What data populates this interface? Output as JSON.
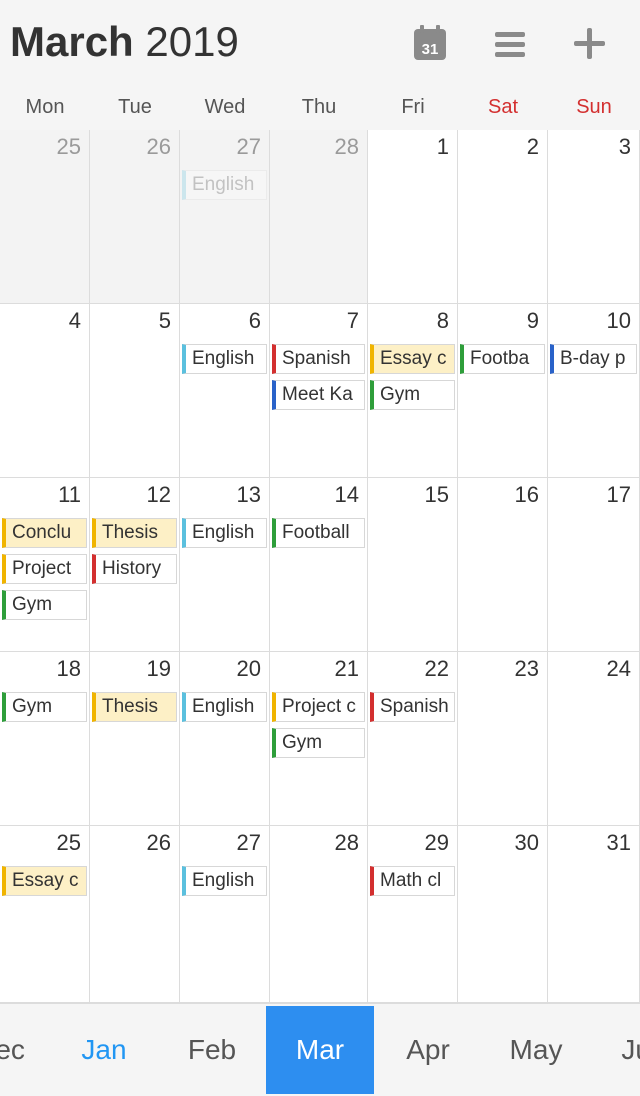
{
  "header": {
    "month": "March",
    "year": "2019",
    "calendar_icon_day": "31"
  },
  "weekdays": [
    "Mon",
    "Tue",
    "Wed",
    "Thu",
    "Fri",
    "Sat",
    "Sun"
  ],
  "weeks": [
    [
      {
        "day": "25",
        "out": true,
        "events": []
      },
      {
        "day": "26",
        "out": true,
        "events": []
      },
      {
        "day": "27",
        "out": true,
        "events": [
          {
            "label": "English",
            "color": "#5bc0de",
            "faded": true
          }
        ]
      },
      {
        "day": "28",
        "out": true,
        "events": []
      },
      {
        "day": "1",
        "events": []
      },
      {
        "day": "2",
        "events": []
      },
      {
        "day": "3",
        "events": []
      }
    ],
    [
      {
        "day": "4",
        "events": []
      },
      {
        "day": "5",
        "events": []
      },
      {
        "day": "6",
        "events": [
          {
            "label": "English",
            "color": "#5bc0de"
          }
        ]
      },
      {
        "day": "7",
        "events": [
          {
            "label": "Spanish",
            "color": "#d32f2f"
          },
          {
            "label": "Meet Ka",
            "color": "#2962c9"
          }
        ]
      },
      {
        "day": "8",
        "events": [
          {
            "label": "Essay c",
            "color": "#f0b400",
            "hl": true
          },
          {
            "label": "Gym",
            "color": "#2e9e3a"
          }
        ]
      },
      {
        "day": "9",
        "events": [
          {
            "label": "Footba",
            "color": "#2e9e3a"
          }
        ]
      },
      {
        "day": "10",
        "events": [
          {
            "label": "B-day p",
            "color": "#2962c9"
          }
        ]
      }
    ],
    [
      {
        "day": "11",
        "events": [
          {
            "label": "Conclu",
            "color": "#f0b400",
            "hl": true
          },
          {
            "label": "Project",
            "color": "#f0b400"
          },
          {
            "label": "Gym",
            "color": "#2e9e3a"
          }
        ]
      },
      {
        "day": "12",
        "events": [
          {
            "label": "Thesis",
            "color": "#f0b400",
            "hl": true
          },
          {
            "label": "History",
            "color": "#d32f2f"
          }
        ]
      },
      {
        "day": "13",
        "events": [
          {
            "label": "English",
            "color": "#5bc0de"
          }
        ]
      },
      {
        "day": "14",
        "events": [
          {
            "label": "Football",
            "color": "#2e9e3a"
          }
        ]
      },
      {
        "day": "15",
        "events": []
      },
      {
        "day": "16",
        "events": []
      },
      {
        "day": "17",
        "events": []
      }
    ],
    [
      {
        "day": "18",
        "events": [
          {
            "label": "Gym",
            "color": "#2e9e3a"
          }
        ]
      },
      {
        "day": "19",
        "events": [
          {
            "label": "Thesis",
            "color": "#f0b400",
            "hl": true
          }
        ]
      },
      {
        "day": "20",
        "events": [
          {
            "label": "English",
            "color": "#5bc0de"
          }
        ]
      },
      {
        "day": "21",
        "events": [
          {
            "label": "Project c",
            "color": "#f0b400"
          },
          {
            "label": "Gym",
            "color": "#2e9e3a"
          }
        ]
      },
      {
        "day": "22",
        "events": [
          {
            "label": "Spanish",
            "color": "#d32f2f"
          }
        ]
      },
      {
        "day": "23",
        "events": []
      },
      {
        "day": "24",
        "events": []
      }
    ],
    [
      {
        "day": "25",
        "events": [
          {
            "label": "Essay c",
            "color": "#f0b400",
            "hl": true
          }
        ]
      },
      {
        "day": "26",
        "events": []
      },
      {
        "day": "27",
        "events": [
          {
            "label": "English",
            "color": "#5bc0de"
          }
        ]
      },
      {
        "day": "28",
        "events": []
      },
      {
        "day": "29",
        "events": [
          {
            "label": "Math cl",
            "color": "#d32f2f"
          }
        ]
      },
      {
        "day": "30",
        "events": []
      },
      {
        "day": "31",
        "events": []
      }
    ]
  ],
  "months": [
    {
      "label": "Dec",
      "state": "normal"
    },
    {
      "label": "Jan",
      "state": "current"
    },
    {
      "label": "Feb",
      "state": "normal"
    },
    {
      "label": "Mar",
      "state": "selected"
    },
    {
      "label": "Apr",
      "state": "normal"
    },
    {
      "label": "May",
      "state": "normal"
    },
    {
      "label": "Jun",
      "state": "normal"
    }
  ]
}
